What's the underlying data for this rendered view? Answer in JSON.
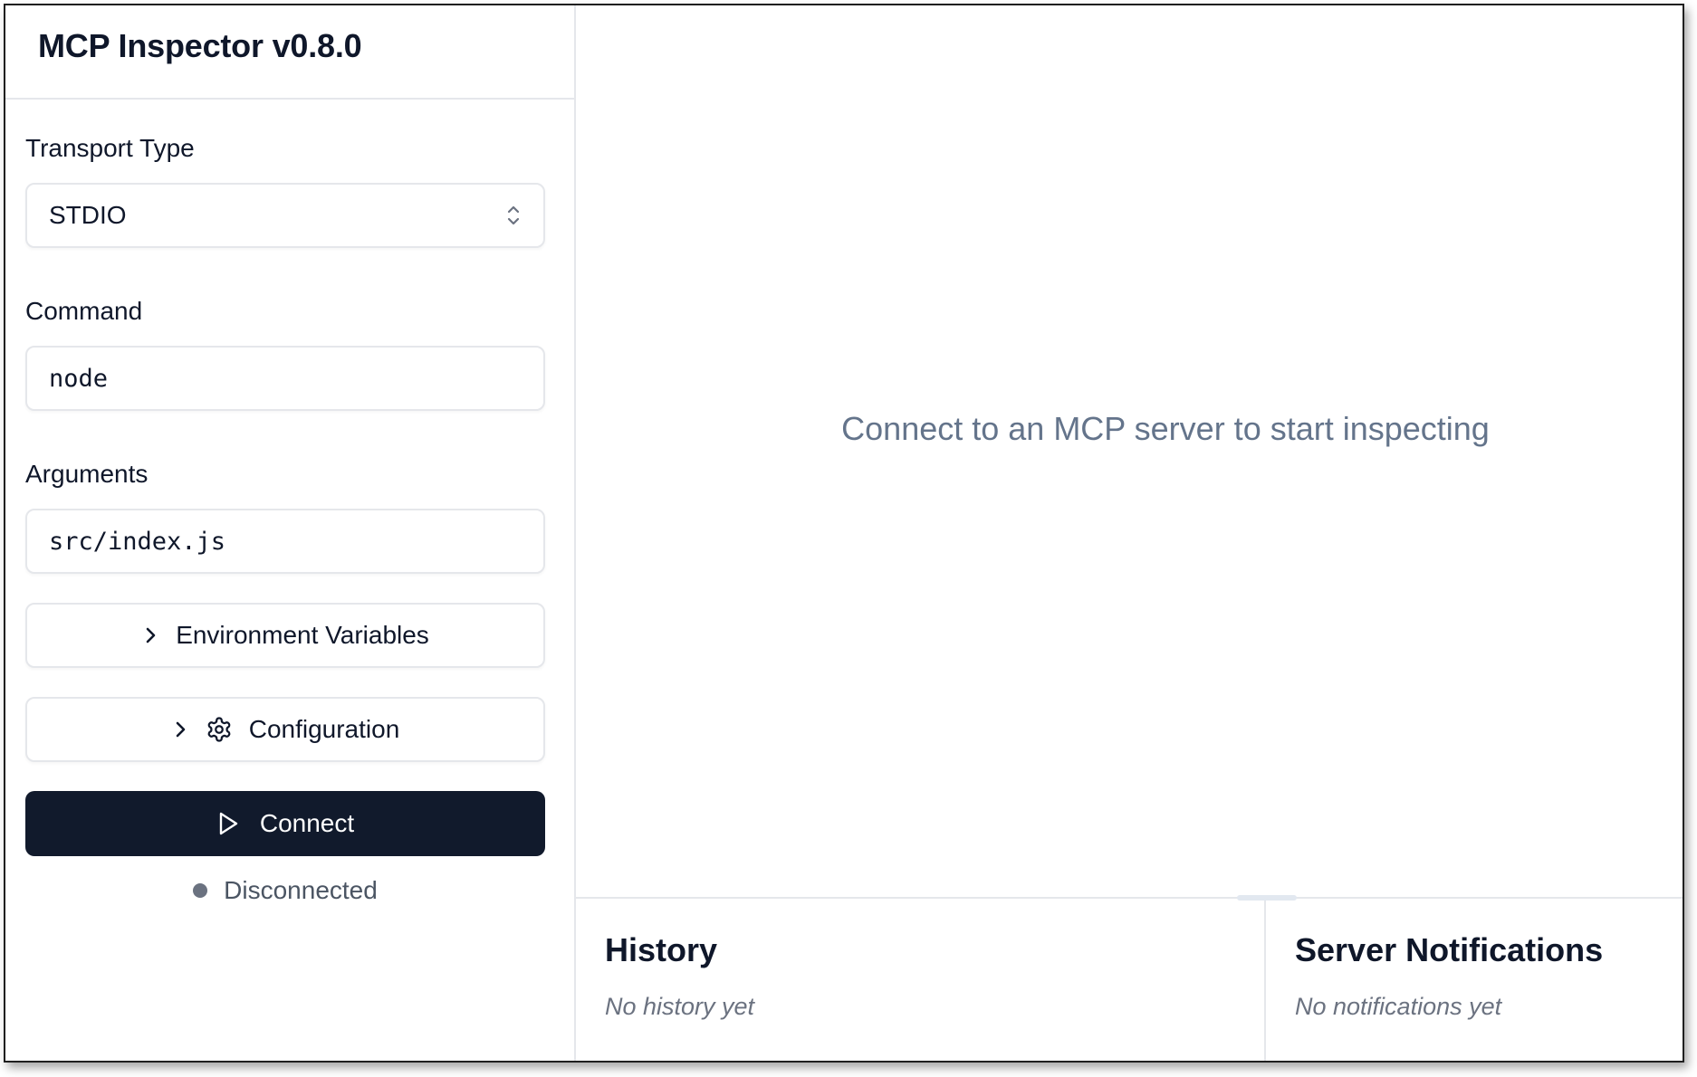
{
  "app": {
    "title": "MCP Inspector v0.8.0"
  },
  "sidebar": {
    "transport": {
      "label": "Transport Type",
      "value": "STDIO",
      "icon": "chevrons-up-down-icon"
    },
    "command": {
      "label": "Command",
      "value": "node"
    },
    "arguments": {
      "label": "Arguments",
      "value": "src/index.js"
    },
    "env_button": {
      "label": "Environment Variables",
      "icon": "chevron-right-icon"
    },
    "config_button": {
      "label": "Configuration",
      "icons": [
        "chevron-right-icon",
        "gear-icon"
      ]
    },
    "connect_button": {
      "label": "Connect",
      "icon": "play-icon"
    },
    "status": {
      "text": "Disconnected",
      "dot_color": "#6b7280"
    }
  },
  "main": {
    "placeholder": "Connect to an MCP server to start inspecting",
    "history": {
      "title": "History",
      "empty": "No history yet"
    },
    "notifications": {
      "title": "Server Notifications",
      "empty": "No notifications yet"
    }
  },
  "colors": {
    "primary": "#111a2c",
    "border": "#e5e7eb",
    "muted": "#64748b"
  }
}
